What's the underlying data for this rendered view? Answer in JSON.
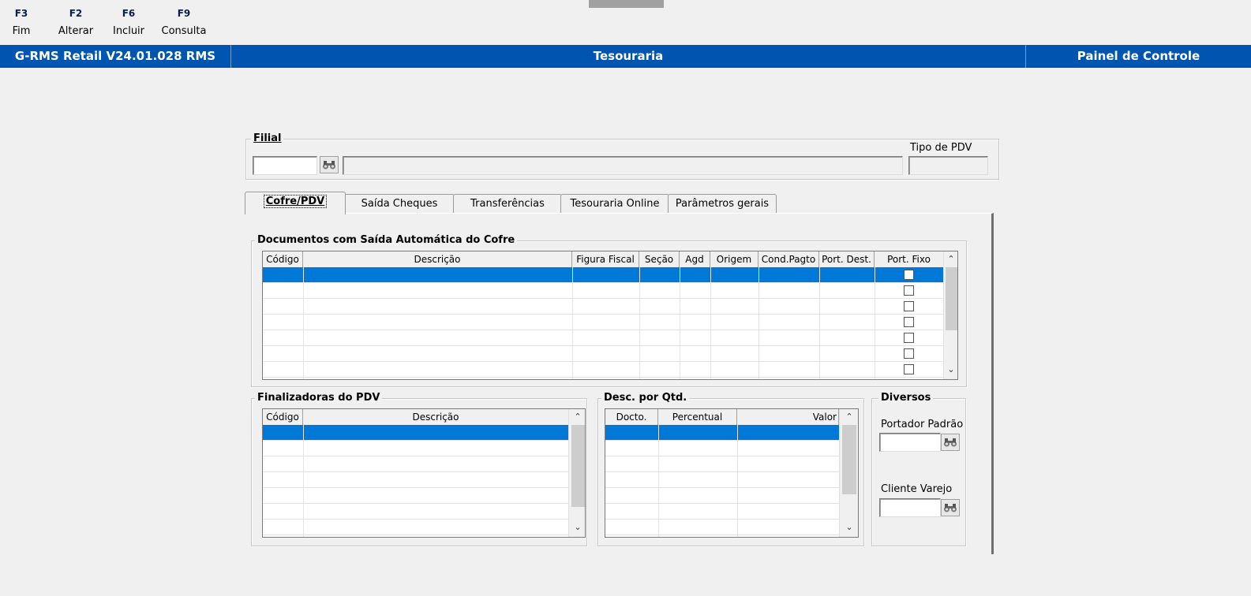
{
  "toolbar": {
    "keys": [
      {
        "key": "F3",
        "label": "Fim"
      },
      {
        "key": "F2",
        "label": "Alterar"
      },
      {
        "key": "F6",
        "label": "Incluir"
      },
      {
        "key": "F9",
        "label": "Consulta"
      }
    ]
  },
  "titlebar": {
    "app": "G-RMS Retail V24.01.028 RMS",
    "module": "Tesouraria",
    "panel": "Painel de Controle"
  },
  "filial": {
    "label": "Filial",
    "code_value": "",
    "name_value": "",
    "tipo_pdv_label": "Tipo de PDV",
    "tipo_pdv_value": ""
  },
  "tabs": [
    "Cofre/PDV",
    "Saída Cheques",
    "Transferências",
    "Tesouraria Online",
    "Parâmetros gerais"
  ],
  "docs": {
    "title": "Documentos com Saída Automática do Cofre",
    "columns": [
      "Código",
      "Descrição",
      "Figura Fiscal",
      "Seção",
      "Agd",
      "Origem",
      "Cond.Pagto",
      "Port. Dest.",
      "Port. Fixo"
    ]
  },
  "finalizadoras": {
    "title": "Finalizadoras do PDV",
    "columns": [
      "Código",
      "Descrição"
    ]
  },
  "desc_qtd": {
    "title": "Desc. por Qtd.",
    "columns": [
      "Docto.",
      "Percentual",
      "Valor"
    ]
  },
  "diversos": {
    "title": "Diversos",
    "portador_label": "Portador Padrão",
    "portador_value": "",
    "cliente_label": "Cliente Varejo",
    "cliente_value": ""
  },
  "colors": {
    "titlebar": "#0055b0",
    "selection": "#0078d7"
  }
}
